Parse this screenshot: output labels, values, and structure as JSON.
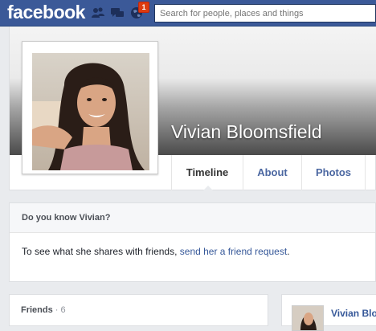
{
  "topbar": {
    "logo": "facebook",
    "badge_count": "1",
    "search_placeholder": "Search for people, places and things"
  },
  "profile": {
    "name": "Vivian Bloomsfield",
    "tabs": [
      {
        "label": "Timeline",
        "active": true
      },
      {
        "label": "About",
        "active": false
      },
      {
        "label": "Photos",
        "active": false
      }
    ]
  },
  "know_box": {
    "title": "Do you know Vivian?",
    "text": "To see what she shares with friends, ",
    "link": "send her a friend request",
    "text_end": "."
  },
  "friends": {
    "title": "Friends",
    "count": "· 6"
  },
  "right_panel": {
    "name": "Vivian Blo"
  },
  "colors": {
    "brand": "#3b5998",
    "link": "#365899",
    "background": "#e9ebee",
    "notification": "#dd3c10"
  }
}
